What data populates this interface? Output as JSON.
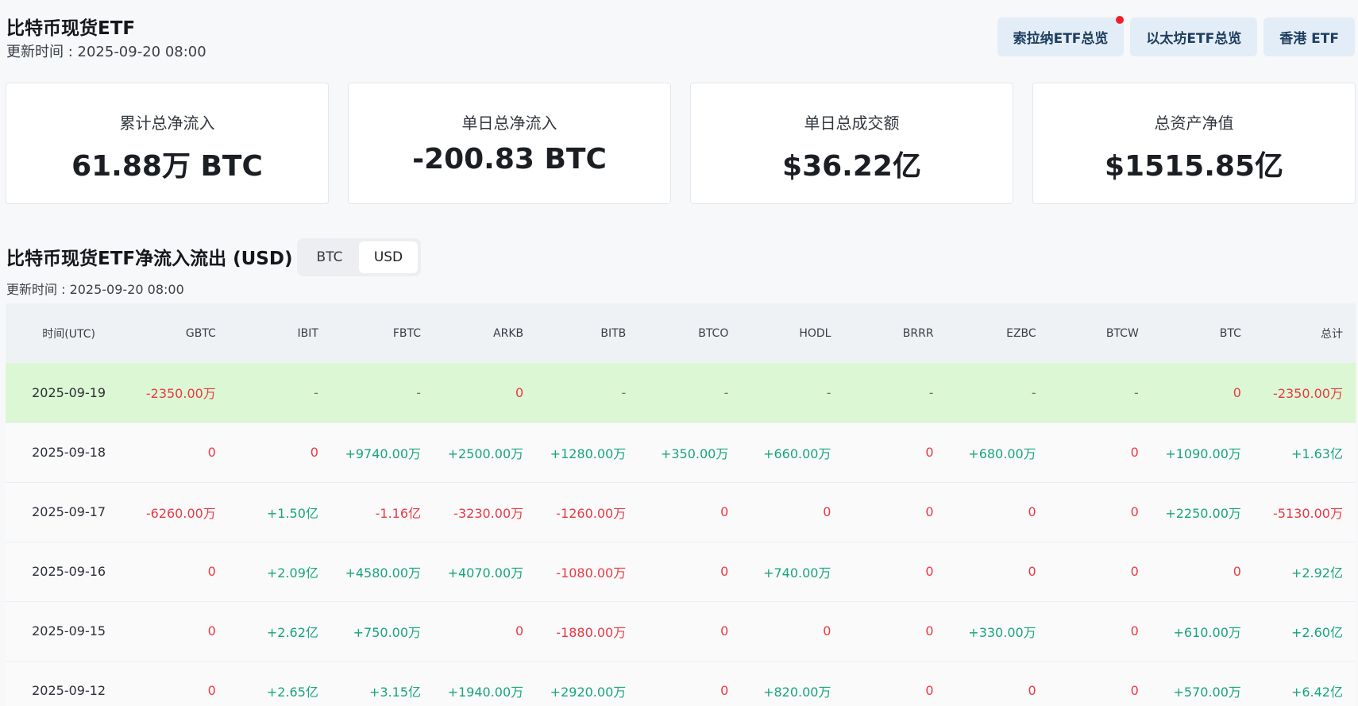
{
  "header": {
    "title": "比特币现货ETF",
    "update_time": "更新时间 : 2025-09-20 08:00"
  },
  "nav": {
    "sol": "索拉纳ETF总览",
    "eth": "以太坊ETF总览",
    "hk": "香港 ETF"
  },
  "stats": {
    "cumulative": {
      "label": "累计总净流入",
      "value": "61.88万 BTC"
    },
    "daily_net": {
      "label": "单日总净流入",
      "value": "-200.83 BTC"
    },
    "daily_volume": {
      "label": "单日总成交额",
      "value": "$36.22亿"
    },
    "total_assets": {
      "label": "总资产净值",
      "value": "$1515.85亿"
    }
  },
  "section": {
    "title": "比特币现货ETF净流入流出 (USD)",
    "update_time": "更新时间 : 2025-09-20 08:00",
    "toggle": {
      "btc": "BTC",
      "usd": "USD",
      "active": "USD"
    }
  },
  "table": {
    "headers": [
      "时间(UTC)",
      "GBTC",
      "IBIT",
      "FBTC",
      "ARKB",
      "BITB",
      "BTCO",
      "HODL",
      "BRRR",
      "EZBC",
      "BTCW",
      "BTC",
      "总计"
    ],
    "rows": [
      [
        "2025-09-19",
        "-2350.00万",
        "-",
        "-",
        "0",
        "-",
        "-",
        "-",
        "-",
        "-",
        "-",
        "0",
        "-2350.00万"
      ],
      [
        "2025-09-18",
        "0",
        "0",
        "+9740.00万",
        "+2500.00万",
        "+1280.00万",
        "+350.00万",
        "+660.00万",
        "0",
        "+680.00万",
        "0",
        "+1090.00万",
        "+1.63亿"
      ],
      [
        "2025-09-17",
        "-6260.00万",
        "+1.50亿",
        "-1.16亿",
        "-3230.00万",
        "-1260.00万",
        "0",
        "0",
        "0",
        "0",
        "0",
        "+2250.00万",
        "-5130.00万"
      ],
      [
        "2025-09-16",
        "0",
        "+2.09亿",
        "+4580.00万",
        "+4070.00万",
        "-1080.00万",
        "0",
        "+740.00万",
        "0",
        "0",
        "0",
        "0",
        "+2.92亿"
      ],
      [
        "2025-09-15",
        "0",
        "+2.62亿",
        "+750.00万",
        "0",
        "-1880.00万",
        "0",
        "0",
        "0",
        "+330.00万",
        "0",
        "+610.00万",
        "+2.60亿"
      ],
      [
        "2025-09-12",
        "0",
        "+2.65亿",
        "+3.15亿",
        "+1940.00万",
        "+2920.00万",
        "0",
        "+820.00万",
        "0",
        "0",
        "0",
        "+570.00万",
        "+6.42亿"
      ]
    ]
  }
}
